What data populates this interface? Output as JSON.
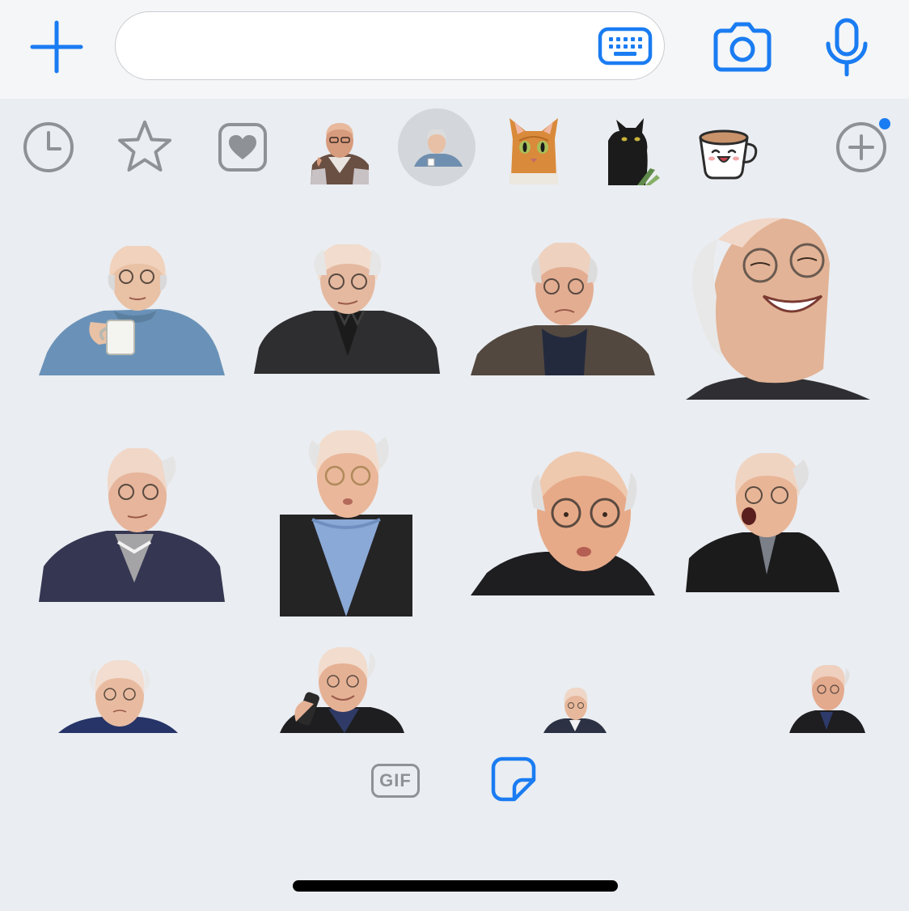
{
  "composer": {
    "message_value": "",
    "message_placeholder": "",
    "add_icon": "plus-icon",
    "keyboard_icon": "keyboard-icon",
    "camera_icon": "camera-icon",
    "mic_icon": "microphone-icon"
  },
  "sticker_tray": {
    "items": [
      {
        "icon": "recent-clock-icon"
      },
      {
        "icon": "favorites-star-icon"
      },
      {
        "icon": "heart-pack-icon"
      },
      {
        "icon": "george-pack-thumbnail"
      },
      {
        "icon": "larry-pack-thumbnail",
        "selected": true
      },
      {
        "icon": "orange-cat-pack-thumbnail"
      },
      {
        "icon": "black-cat-pack-thumbnail"
      },
      {
        "icon": "coffee-cup-pack-thumbnail"
      },
      {
        "icon": "add-pack-icon"
      }
    ],
    "has_notification": true
  },
  "stickers": [
    "larry-coffee-mug",
    "larry-smirk",
    "larry-frown",
    "larry-laughing",
    "larry-side-glance",
    "larry-pursed-lips",
    "larry-stare",
    "larry-shocked",
    "larry-blank-stare",
    "larry-phone-call",
    "larry-small",
    "larry-turning"
  ],
  "bottom_tabs": {
    "gif_label": "GIF",
    "sticker_icon": "sticker-icon",
    "active": "stickers"
  },
  "colors": {
    "accent": "#1a7cf2",
    "icon_gray": "#8e9196",
    "background": "#eaedf1",
    "selected_bg": "#d3d6da"
  }
}
